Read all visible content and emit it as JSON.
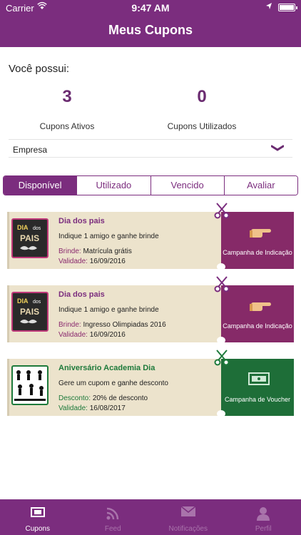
{
  "status": {
    "carrier": "Carrier",
    "time": "9:47 AM"
  },
  "nav": {
    "title": "Meus Cupons"
  },
  "summary": {
    "intro": "Você possui:",
    "active_count": "3",
    "active_label": "Cupons Ativos",
    "used_count": "0",
    "used_label": "Cupons Utilizados"
  },
  "filter": {
    "company": "Empresa"
  },
  "tabs": [
    {
      "label": "Disponível"
    },
    {
      "label": "Utilizado"
    },
    {
      "label": "Vencido"
    },
    {
      "label": "Avaliar"
    }
  ],
  "coupons": [
    {
      "title": "Dia dos pais",
      "desc": "Indique 1 amigo e ganhe brinde",
      "k1": "Brinde:",
      "v1": "Matrícula grátis",
      "k2": "Validade:",
      "v2": "16/09/2016",
      "campaign": "Campanha de Indicação",
      "color": "#862a68"
    },
    {
      "title": "Dia dos pais",
      "desc": "Indique 1 amigo e ganhe brinde",
      "k1": "Brinde:",
      "v1": "Ingresso Olimpiadas 2016",
      "k2": "Validade:",
      "v2": "16/09/2016",
      "campaign": "Campanha de Indicação",
      "color": "#862a68"
    },
    {
      "title": "Aniversário Academia Dia",
      "desc": "Gere um cupom e ganhe desconto",
      "k1": "Desconto:",
      "v1": "20% de desconto",
      "k2": "Validade:",
      "v2": "16/08/2017",
      "campaign": "Campanha de Voucher",
      "color": "#1e6e38"
    }
  ],
  "tabbar": [
    {
      "label": "Cupons",
      "icon": "ticket-icon"
    },
    {
      "label": "Feed",
      "icon": "rss-icon"
    },
    {
      "label": "Notificações",
      "icon": "envelope-icon"
    },
    {
      "label": "Perfil",
      "icon": "person-icon"
    }
  ],
  "colors": {
    "brand": "#7b2d7e",
    "indicacao": "#862a68",
    "voucher": "#1e6e38"
  }
}
